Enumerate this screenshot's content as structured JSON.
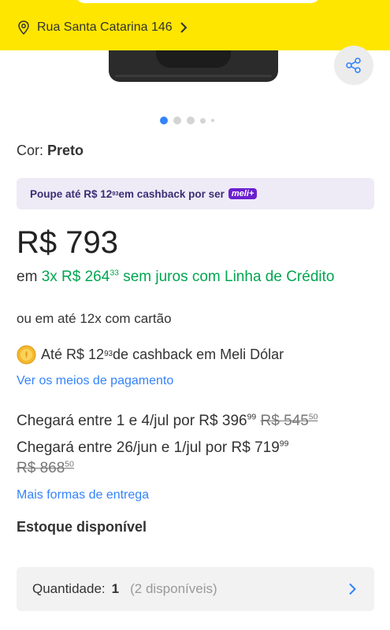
{
  "header": {
    "address": "Rua Santa Catarina 146",
    "icons": {
      "location": "location-pin-icon",
      "chevron": "chevron-right-icon"
    },
    "colors": {
      "background": "#ffe600"
    }
  },
  "gallery": {
    "share_icon": "share-icon",
    "pagination": {
      "active_index": 0
    }
  },
  "product": {
    "color_label": "Cor: ",
    "color_value": "Preto",
    "cashback_banner": {
      "prefix": "Poupe até R$ 12",
      "cents": "93",
      "suffix": " em cashback por ser ",
      "badge": "meli+"
    },
    "price": "R$ 793",
    "installments": {
      "prefix": "em ",
      "highlight": "3x R$ 264",
      "cents": "33",
      "suffix": " sem juros com Linha de Crédito"
    },
    "card_installments": "ou em até 12x com cartão",
    "cashback": {
      "prefix": "Até R$ 12",
      "cents": "93",
      "suffix": " de cashback em Meli Dólar",
      "icon": "coin-icon"
    },
    "payment_link": "Ver os meios de pagamento"
  },
  "shipping": {
    "options": [
      {
        "text": "Chegará entre 1 e 4/jul por R$ 396",
        "cents": "99",
        "old_price": "R$ 545",
        "old_cents": "50"
      },
      {
        "text": "Chegará entre 26/jun e 1/jul por R$ 719",
        "cents": "99",
        "old_price": "R$ 868",
        "old_cents": "50"
      }
    ],
    "more_link": "Mais formas de entrega"
  },
  "stock": {
    "label": "Estoque disponível",
    "quantity_label": "Quantidade:",
    "quantity_value": "1",
    "available": "(2 disponíveis)"
  },
  "colors": {
    "accent": "#3483fa",
    "green": "#00a650",
    "meli_plus": "#6a1fd0"
  }
}
